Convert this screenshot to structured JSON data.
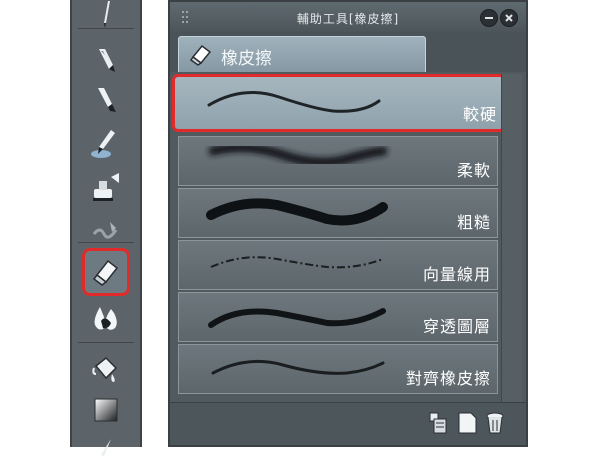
{
  "palette": {
    "title": "輔助工具[橡皮擦]",
    "tab_label": "橡皮擦",
    "items": [
      {
        "label": "較硬"
      },
      {
        "label": "柔軟"
      },
      {
        "label": "粗糙"
      },
      {
        "label": "向量線用"
      },
      {
        "label": "穿透圖層"
      },
      {
        "label": "對齊橡皮擦"
      }
    ]
  },
  "colors": {
    "highlight": "#e12b2b",
    "panel_bg": "#505a5f",
    "active_item": "#9aaeb8",
    "text": "#ffffff"
  },
  "toolstrip": {
    "tools": [
      {
        "icon": "pen-icon"
      },
      {
        "icon": "fountain-pen-icon"
      },
      {
        "icon": "brush-icon"
      },
      {
        "icon": "airbrush-icon"
      },
      {
        "icon": "stamp-icon"
      },
      {
        "icon": "decoration-icon"
      },
      {
        "icon": "eraser-icon",
        "selected": true
      },
      {
        "icon": "blend-icon"
      },
      {
        "icon": "fill-bucket-icon"
      },
      {
        "icon": "gradient-icon"
      }
    ]
  }
}
